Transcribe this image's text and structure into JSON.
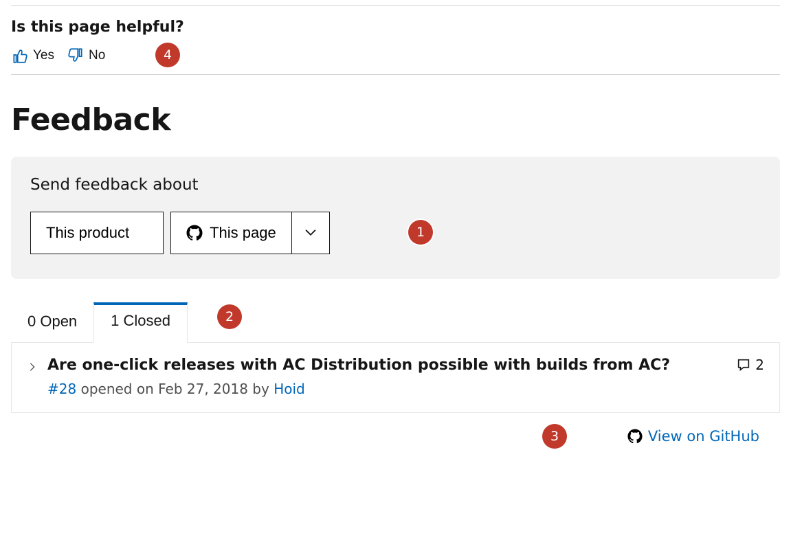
{
  "helpful": {
    "title": "Is this page helpful?",
    "yes": "Yes",
    "no": "No"
  },
  "feedback": {
    "heading": "Feedback",
    "send_about": "Send feedback about",
    "product_btn": "This product",
    "page_btn": "This page"
  },
  "tabs": {
    "open": "0 Open",
    "closed": "1 Closed"
  },
  "issue": {
    "title": "Are one-click releases with AC Distribution possible with builds from AC?",
    "number": "#28",
    "meta_text": "opened on Feb 27, 2018 by",
    "author": "Hoid",
    "comments": "2"
  },
  "footer": {
    "view_github": "View on GitHub"
  },
  "badges": {
    "b1": "1",
    "b2": "2",
    "b3": "3",
    "b4": "4"
  }
}
